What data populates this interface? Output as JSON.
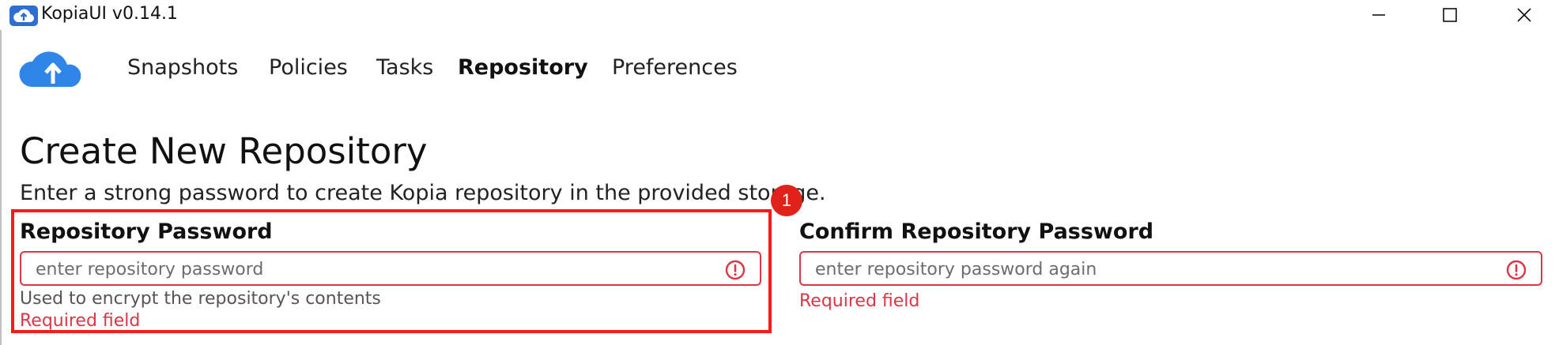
{
  "window": {
    "title": "KopiaUI v0.14.1",
    "controls": [
      "minimize-icon",
      "maximize-icon",
      "close-icon"
    ]
  },
  "nav": {
    "items": [
      {
        "label": "Snapshots",
        "active": false
      },
      {
        "label": "Policies",
        "active": false
      },
      {
        "label": "Tasks",
        "active": false
      },
      {
        "label": "Repository",
        "active": true
      },
      {
        "label": "Preferences",
        "active": false
      }
    ]
  },
  "main": {
    "title": "Create New Repository",
    "subtitle": "Enter a strong password to create Kopia repository in the provided storage.",
    "password": {
      "label": "Repository Password",
      "placeholder": "enter repository password",
      "value": "",
      "helper": "Used to encrypt the repository's contents",
      "error": "Required field"
    },
    "confirm": {
      "label": "Confirm Repository Password",
      "placeholder": "enter repository password again",
      "value": "",
      "error": "Required field"
    }
  },
  "annotation": {
    "badge": "1"
  },
  "colors": {
    "error": "#dc3545",
    "accent": "#2c6fd1",
    "annotation": "#ff1a1a"
  }
}
